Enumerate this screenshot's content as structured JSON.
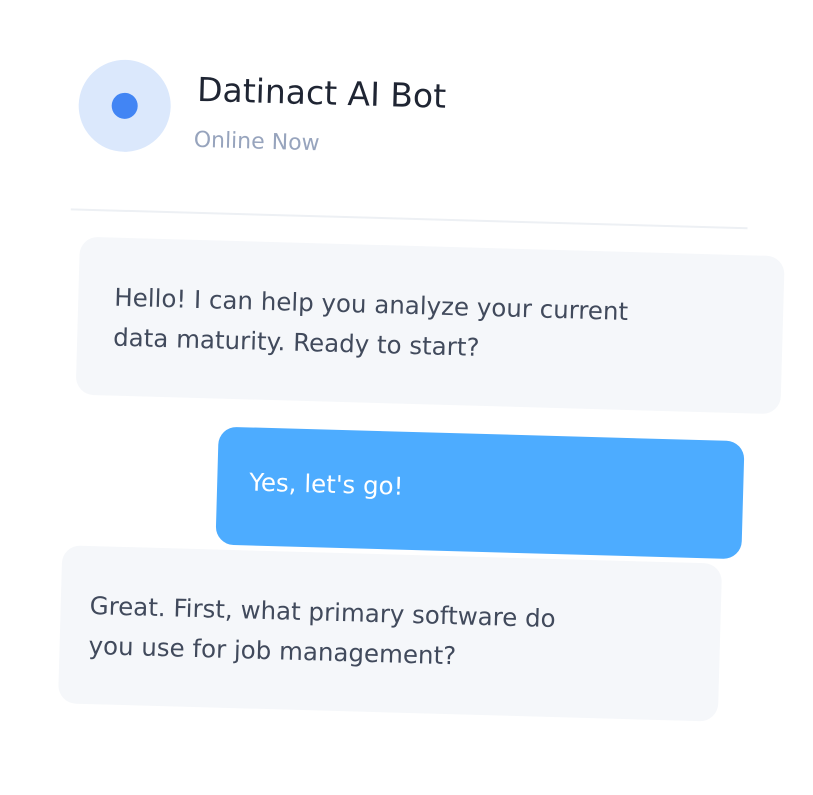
{
  "header": {
    "bot_name": "Datinact AI Bot",
    "status": "Online Now"
  },
  "messages": [
    {
      "sender": "bot",
      "lines": [
        "Hello! I can help you analyze your current",
        "data maturity. Ready to start?"
      ]
    },
    {
      "sender": "user",
      "lines": [
        "Yes, let's go!"
      ]
    },
    {
      "sender": "bot",
      "lines": [
        "Great. First, what primary software do",
        "you use for job management?"
      ]
    }
  ],
  "colors": {
    "avatar_bg": "#dbe8fc",
    "avatar_dot": "#4285f4",
    "user_bubble": "#4dacff",
    "bot_bubble": "#f5f7fa",
    "title_text": "#1f2533",
    "status_text": "#97a4bd"
  }
}
